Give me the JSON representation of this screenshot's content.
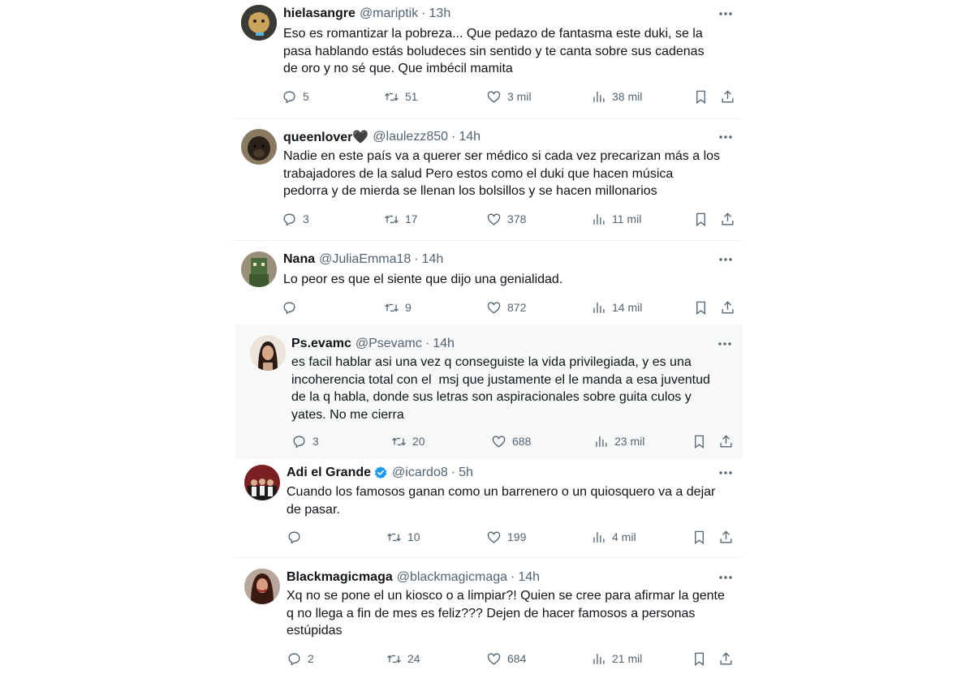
{
  "tweets": [
    {
      "name": "hielasangre",
      "handle": "@mariptik",
      "time": "13h",
      "text": "Eso es romantizar la pobreza... Que pedazo de fantasma este duki, se la\npasa hablando estás boludeces sin sentido y te canta sobre sus cadenas\nde oro y no sé que. Que imbécil mamita",
      "replies": "5",
      "retweets": "51",
      "likes": "3 mil",
      "views": "38 mil"
    },
    {
      "name": "queenlover🖤",
      "handle": "@laulezz850",
      "time": "14h",
      "text": "Nadie en este país va a querer ser médico si cada vez precarizan más a los\ntrabajadores de la salud Pero estos como el duki que hacen música\npedorra y de mierda se llenan los bolsillos y se hacen millonarios",
      "replies": "3",
      "retweets": "17",
      "likes": "378",
      "views": "11 mil"
    },
    {
      "name": "Nana",
      "handle": "@JuliaEmma18",
      "time": "14h",
      "text": "Lo peor es que el siente que dijo una genialidad.",
      "replies": "",
      "retweets": "9",
      "likes": "872",
      "views": "14 mil"
    },
    {
      "name": "Ps.evamc",
      "handle": "@Psevamc",
      "time": "14h",
      "text": "es facil hablar asi una vez q conseguiste la vida privilegiada, y es una\nincoherencia total con el  msj que justamente el le manda a esa juventud\nde la q habla, donde sus letras son aspiracionales sobre guita culos y\nyates. No me cierra",
      "replies": "3",
      "retweets": "20",
      "likes": "688",
      "views": "23 mil"
    },
    {
      "name": "Adi el Grande",
      "handle": "@icardo8",
      "time": "5h",
      "text": "Cuando los famosos ganan como un barrenero o un quiosquero va a dejar\nde pasar.",
      "replies": "",
      "retweets": "10",
      "likes": "199",
      "views": "4 mil"
    },
    {
      "name": "Blackmagicmaga",
      "handle": "@blackmagicmaga",
      "time": "14h",
      "text": "Xq no se pone el un kiosco o a limpiar?! Quien se cree para afirmar la gente\nq no llega a fin de mes es feliz??? Dejen de hacer famosos a personas\nestúpidas",
      "replies": "2",
      "retweets": "24",
      "likes": "684",
      "views": "21 mil"
    }
  ],
  "separator": "·",
  "colors": {
    "text": "#0f1419",
    "secondary": "#536471",
    "verified": "#1d9bf0",
    "highlight_bg": "#f7f9f9",
    "border": "#eff3f4"
  },
  "icons": [
    "reply-icon",
    "retweet-icon",
    "like-icon",
    "views-icon",
    "bookmark-icon",
    "share-icon",
    "more-icon",
    "verified-badge-icon"
  ]
}
